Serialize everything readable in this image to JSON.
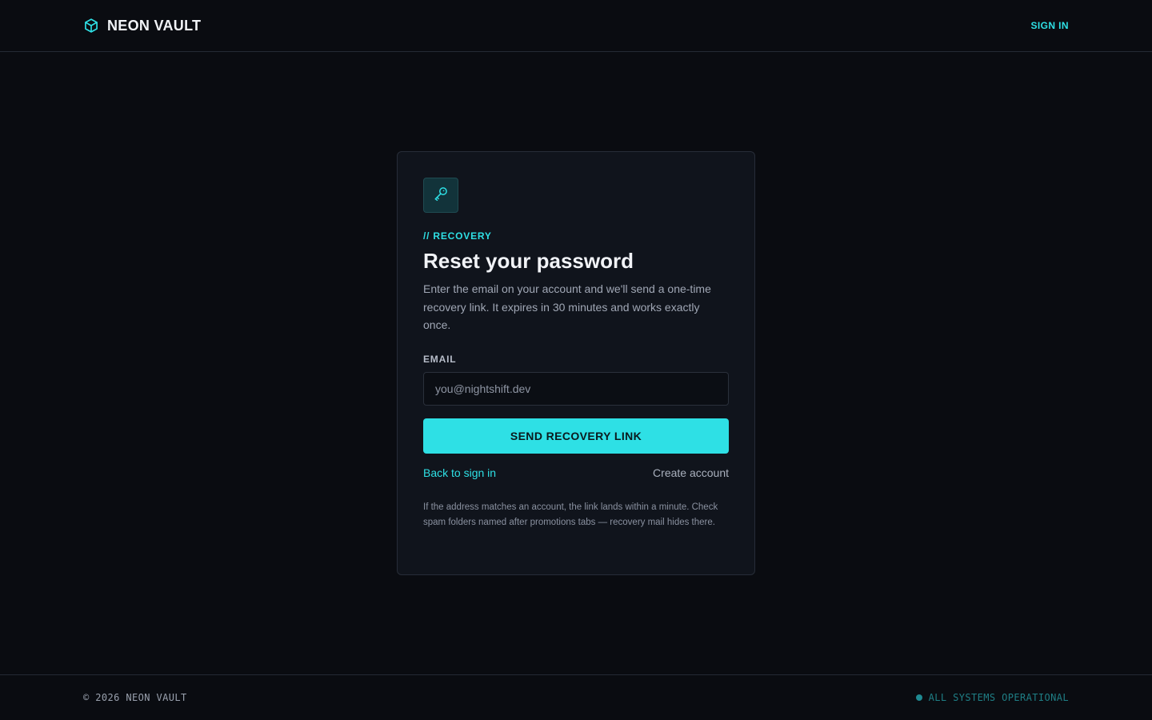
{
  "header": {
    "brand": "NEON VAULT",
    "signin_label": "SIGN IN"
  },
  "card": {
    "eyebrow": "// RECOVERY",
    "title": "Reset your password",
    "description": "Enter the email on your account and we'll send a one-time recovery link. It expires in 30 minutes and works exactly once.",
    "email_label": "EMAIL",
    "email_placeholder": "you@nightshift.dev",
    "email_value": "",
    "send_label": "SEND RECOVERY LINK",
    "back_label": "Back to sign in",
    "create_label": "Create account",
    "note": "If the address matches an account, the link lands within a minute. Check spam folders named after promotions tabs — recovery mail hides there."
  },
  "footer": {
    "copyright": "© 2026 NEON VAULT",
    "status": "ALL SYSTEMS OPERATIONAL"
  },
  "icons": {
    "brand": "cube-icon",
    "card": "key-icon",
    "status": "status-dot-icon"
  },
  "colors": {
    "accent": "#2ee0e5",
    "background": "#0a0c11",
    "card": "#10141c",
    "status": "#1f8a92"
  }
}
